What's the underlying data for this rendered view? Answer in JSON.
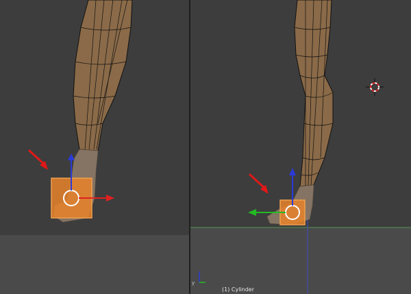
{
  "editor": {
    "active_object_label": "(1) Cylinder",
    "views": [
      {
        "name": "left-viewport"
      },
      {
        "name": "right-viewport"
      }
    ]
  },
  "colors": {
    "background": "#3d3d3d",
    "floor": "#4a4a4a",
    "mesh_fill": "#8a6a48",
    "selection": "#e8832a",
    "axis_x": "#e02020",
    "axis_y": "#22bb22",
    "axis_z": "#2a3ad8",
    "annotation_arrow": "#e01818"
  },
  "icons": [
    "3d-cursor-icon",
    "axis-gizmo-icon",
    "annotation-arrow-icon"
  ]
}
